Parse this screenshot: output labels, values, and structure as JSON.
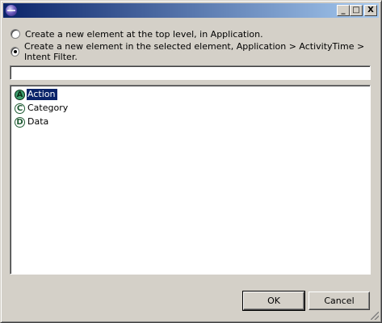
{
  "window": {
    "title": "",
    "controls": {
      "minimize": "_",
      "maximize": "□",
      "close": "X"
    }
  },
  "options": [
    {
      "label": "Create a new element at the top level, in Application.",
      "checked": false
    },
    {
      "label": "Create a new element in the selected element, Application > ActivityTime > Intent Filter.",
      "checked": true
    }
  ],
  "filter": {
    "value": "",
    "placeholder": ""
  },
  "list": {
    "items": [
      {
        "icon": "A",
        "icon_name": "action-element-icon",
        "label": "Action",
        "selected": true
      },
      {
        "icon": "C",
        "icon_name": "category-element-icon",
        "label": "Category",
        "selected": false
      },
      {
        "icon": "D",
        "icon_name": "data-element-icon",
        "label": "Data",
        "selected": false
      }
    ]
  },
  "buttons": {
    "ok": "OK",
    "cancel": "Cancel"
  },
  "colors": {
    "title_start": "#0a246a",
    "title_end": "#a6caf0",
    "selection": "#0a246a",
    "icon_green": "#3f9f6f"
  }
}
